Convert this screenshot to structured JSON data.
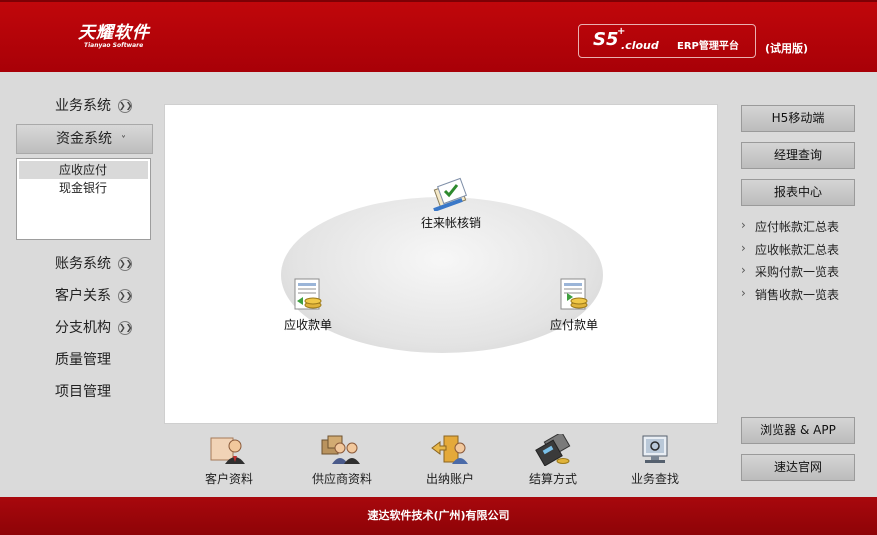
{
  "header": {
    "logo_cn": "天耀软件",
    "logo_en": "Tianyao Software",
    "product_s5": "S5",
    "product_plus": "+",
    "product_cloud": ".cloud",
    "product_platform": "ERP管理平台",
    "trial": "(试用版)"
  },
  "left_nav": {
    "items": [
      {
        "label": "业务系统"
      },
      {
        "label": "资金系统"
      },
      {
        "label": "账务系统"
      },
      {
        "label": "客户关系"
      },
      {
        "label": "分支机构"
      },
      {
        "label": "质量管理"
      },
      {
        "label": "项目管理"
      }
    ],
    "submenu": [
      {
        "label": "应收应付"
      },
      {
        "label": "现金银行"
      }
    ]
  },
  "main": {
    "nodes": {
      "reconcile": "往来帐核销",
      "receivable": "应收款单",
      "payable": "应付款单"
    }
  },
  "toolbar": {
    "items": [
      {
        "label": "客户资料",
        "icon": "customer-icon"
      },
      {
        "label": "供应商资料",
        "icon": "supplier-icon"
      },
      {
        "label": "出纳账户",
        "icon": "cashier-icon"
      },
      {
        "label": "结算方式",
        "icon": "settlement-icon"
      },
      {
        "label": "业务查找",
        "icon": "search-icon"
      }
    ]
  },
  "right": {
    "h5": "H5移动端",
    "manager": "经理查询",
    "report_center": "报表中心",
    "reports": [
      {
        "label": "应付帐款汇总表"
      },
      {
        "label": "应收帐款汇总表"
      },
      {
        "label": "采购付款一览表"
      },
      {
        "label": "销售收款一览表"
      }
    ],
    "browser_app": "浏览器 & APP",
    "website": "速达官网"
  },
  "footer": {
    "company": "速达软件技术(广州)有限公司"
  },
  "colors": {
    "brand_red": "#b00009",
    "footer_red": "#9a0509"
  }
}
